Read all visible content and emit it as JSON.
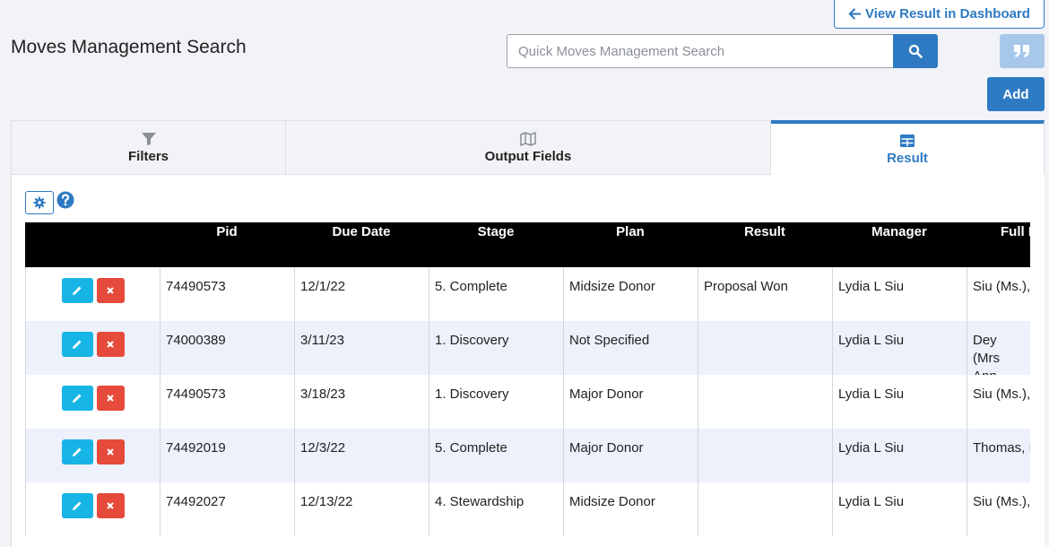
{
  "header": {
    "title": "Moves Management Search",
    "view_dashboard_label": "View Result in Dashboard",
    "search_placeholder": "Quick Moves Management Search",
    "search_value": "",
    "add_label": "Add"
  },
  "tabs": [
    {
      "label": "Filters",
      "icon": "filter-icon"
    },
    {
      "label": "Output Fields",
      "icon": "map-icon"
    },
    {
      "label": "Result",
      "icon": "table-icon",
      "active": true
    }
  ],
  "colors": {
    "accent": "#2e7ac2",
    "edit": "#17b5e6",
    "delete": "#e54a3b",
    "row_alt": "#ecf1fb"
  },
  "table": {
    "columns": [
      "",
      "Pid",
      "Due Date",
      "Stage",
      "Plan",
      "Result",
      "Manager",
      "Full N"
    ],
    "rows": [
      [
        "74490573",
        "12/1/22",
        "5. Complete",
        "Midsize Donor",
        "Proposal Won",
        "Lydia L Siu",
        "Siu (Ms.),"
      ],
      [
        "74000389",
        "3/11/23",
        "1. Discovery",
        "Not Specified",
        "",
        "Lydia L Siu",
        "Dey (Mrs Ann"
      ],
      [
        "74490573",
        "3/18/23",
        "1. Discovery",
        "Major Donor",
        "",
        "Lydia L Siu",
        "Siu (Ms.),"
      ],
      [
        "74492019",
        "12/3/22",
        "5. Complete",
        "Major Donor",
        "",
        "Lydia L Siu",
        "Thomas, I"
      ],
      [
        "74492027",
        "12/13/22",
        "4. Stewardship",
        "Midsize Donor",
        "",
        "Lydia L Siu",
        "Siu (Ms.),"
      ]
    ]
  }
}
